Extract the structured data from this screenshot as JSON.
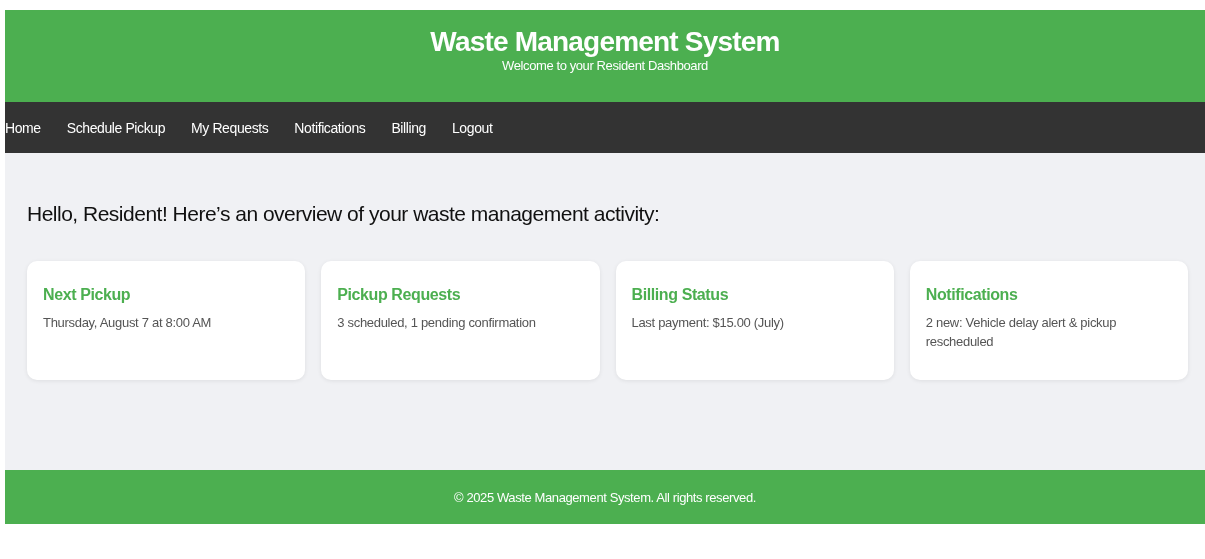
{
  "header": {
    "title": "Waste Management System",
    "subtitle": "Welcome to your Resident Dashboard"
  },
  "nav": [
    "Home",
    "Schedule Pickup",
    "My Requests",
    "Notifications",
    "Billing",
    "Logout"
  ],
  "greeting": "Hello, Resident! Here’s an overview of your waste management activity:",
  "cards": [
    {
      "title": "Next Pickup",
      "text": "Thursday, August 7 at 8:00 AM"
    },
    {
      "title": "Pickup Requests",
      "text": "3 scheduled, 1 pending confirmation"
    },
    {
      "title": "Billing Status",
      "text": "Last payment: $15.00 (July)"
    },
    {
      "title": "Notifications",
      "text": "2 new: Vehicle delay alert & pickup rescheduled"
    }
  ],
  "footer": "© 2025 Waste Management System. All rights reserved."
}
